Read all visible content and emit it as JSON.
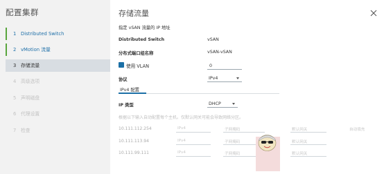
{
  "sidebar": {
    "title": "配置集群",
    "steps": [
      {
        "num": "1",
        "label": "Distributed Switch"
      },
      {
        "num": "2",
        "label": "vMotion 流量"
      },
      {
        "num": "3",
        "label": "存储流量"
      },
      {
        "num": "4",
        "label": "高级选项"
      },
      {
        "num": "5",
        "label": "声明磁盘"
      },
      {
        "num": "6",
        "label": "代理设置"
      },
      {
        "num": "7",
        "label": "检查"
      }
    ]
  },
  "main": {
    "title": "存储流量",
    "subtitle": "指定 vSAN 流量的 IP 地址",
    "distributed_switch_label": "Distributed Switch",
    "distributed_switch_value": "vSAN",
    "port_group_label": "分布式端口组名称",
    "port_group_value": "vSAN-vSAN",
    "vlan_label": "使用 VLAN",
    "vlan_value": "0",
    "protocol_label": "协议",
    "protocol_value": "IPv4",
    "tab_label": "IPv4 配置",
    "ip_type_label": "IP 类型",
    "ip_type_value": "DHCP",
    "hint": "根据以下输入自动配置每个主机。仅默认网关可能会导致网络分区。",
    "autofill_link": "自动填充",
    "placeholders": {
      "ipv4": "IPv4",
      "subnet": "子网掩码",
      "gateway": "默认网关"
    },
    "hosts": [
      "10.111.112.254",
      "10.111.113.94",
      "10.111.99.111"
    ]
  },
  "colors": {
    "accent": "#1b6fa6",
    "done": "#58a53c"
  }
}
